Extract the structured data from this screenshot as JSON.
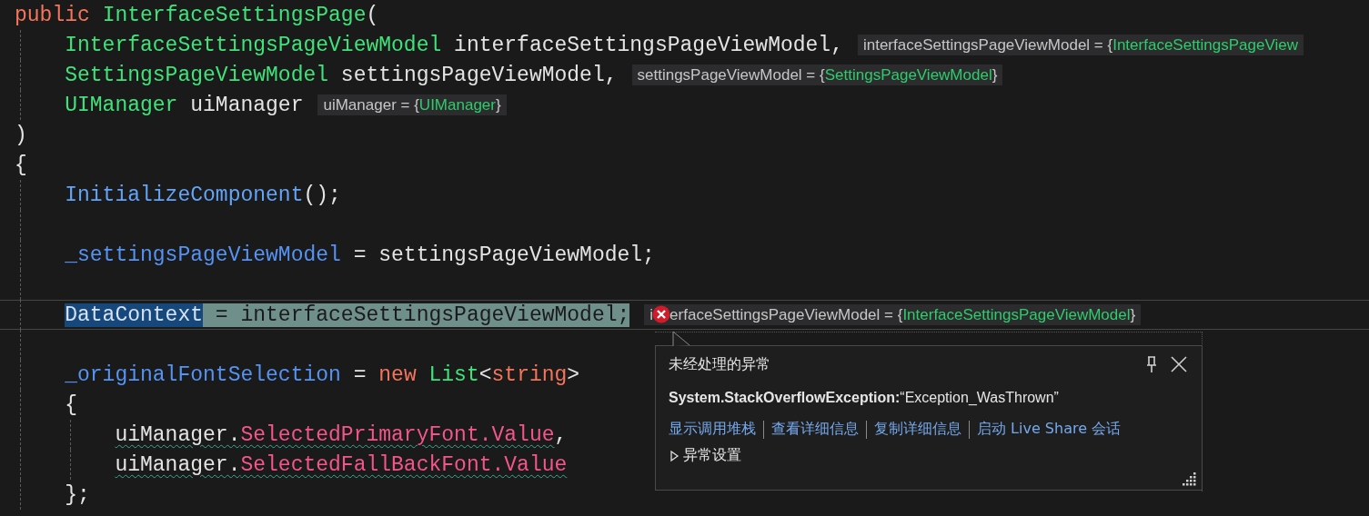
{
  "editor": {
    "lines": [
      {
        "tokens": [
          {
            "kind": "keyword",
            "text": "public "
          },
          {
            "kind": "type",
            "text": "InterfaceSettingsPage"
          },
          {
            "kind": "plain",
            "text": "("
          }
        ]
      },
      {
        "tokens": [
          {
            "kind": "type",
            "text": "    InterfaceSettingsPageViewModel"
          },
          {
            "kind": "plain",
            "text": " interfaceSettingsPageViewModel,"
          }
        ],
        "hint": [
          {
            "kind": "plain",
            "text": "interfaceSettingsPageViewModel = {"
          },
          {
            "kind": "type",
            "text": "InterfaceSettingsPageView"
          }
        ]
      },
      {
        "tokens": [
          {
            "kind": "type",
            "text": "    SettingsPageViewModel"
          },
          {
            "kind": "plain",
            "text": " settingsPageViewModel,"
          }
        ],
        "hint": [
          {
            "kind": "plain",
            "text": "settingsPageViewModel = {"
          },
          {
            "kind": "type",
            "text": "SettingsPageViewModel"
          },
          {
            "kind": "plain",
            "text": "}"
          }
        ]
      },
      {
        "tokens": [
          {
            "kind": "type",
            "text": "    UIManager"
          },
          {
            "kind": "plain",
            "text": " uiManager"
          }
        ],
        "hint": [
          {
            "kind": "plain",
            "text": "uiManager = {"
          },
          {
            "kind": "type",
            "text": "UIManager"
          },
          {
            "kind": "plain",
            "text": "}"
          }
        ]
      },
      {
        "tokens": [
          {
            "kind": "plain",
            "text": ")"
          }
        ]
      },
      {
        "tokens": [
          {
            "kind": "plain",
            "text": "{"
          }
        ]
      },
      {
        "tokens": [
          {
            "kind": "method",
            "text": "    InitializeComponent"
          },
          {
            "kind": "plain",
            "text": "();"
          }
        ]
      },
      {
        "kind": "blank"
      },
      {
        "tokens": [
          {
            "kind": "field",
            "text": "    _settingsPageViewModel"
          },
          {
            "kind": "plain",
            "text": " = settingsPageViewModel;"
          }
        ]
      },
      {
        "kind": "blank"
      },
      {
        "current": true,
        "tokens": [
          {
            "kind": "field",
            "text": "    DataContext",
            "selected": true,
            "highlighted": false
          },
          {
            "kind": "plain",
            "text": " = interfaceSettingsPageViewModel;",
            "selected": false,
            "highlighted": true
          }
        ],
        "hint": [
          {
            "kind": "plain",
            "text": "i"
          },
          {
            "kind": "error"
          },
          {
            "kind": "plain",
            "text": "erfaceSettingsPageViewModel = {"
          },
          {
            "kind": "type",
            "text": "InterfaceSettingsPageViewModel"
          },
          {
            "kind": "plain",
            "text": "}"
          }
        ]
      },
      {
        "kind": "blank"
      },
      {
        "tokens": [
          {
            "kind": "field",
            "text": "    _originalFontSelection"
          },
          {
            "kind": "plain",
            "text": " = "
          },
          {
            "kind": "keyword",
            "text": "new "
          },
          {
            "kind": "type",
            "text": "List"
          },
          {
            "kind": "plain",
            "text": "<"
          },
          {
            "kind": "keyword",
            "text": "string"
          },
          {
            "kind": "plain",
            "text": ">"
          }
        ]
      },
      {
        "tokens": [
          {
            "kind": "plain",
            "text": "    {"
          }
        ]
      },
      {
        "tokens": [
          {
            "kind": "plain",
            "text": "        uiManager.",
            "squiggle": true
          },
          {
            "kind": "property",
            "text": "SelectedPrimaryFont.Value",
            "squiggle": true
          },
          {
            "kind": "plain",
            "text": ",",
            "squiggle": false
          }
        ]
      },
      {
        "tokens": [
          {
            "kind": "plain",
            "text": "        uiManager.",
            "squiggle": true
          },
          {
            "kind": "property",
            "text": "SelectedFallBackFont.Value",
            "squiggle": true
          }
        ]
      },
      {
        "tokens": [
          {
            "kind": "plain",
            "text": "    };"
          }
        ]
      }
    ]
  },
  "exception_popup": {
    "title": "未经处理的异常",
    "message": "**System.StackOverflowException:**“Exception_WasThrown”",
    "links": [
      "显示调用堆栈",
      "查看详细信息",
      "复制详细信息",
      "启动 Live Share 会话"
    ],
    "settings": {
      "label": "异常设置",
      "expanded": false
    }
  }
}
